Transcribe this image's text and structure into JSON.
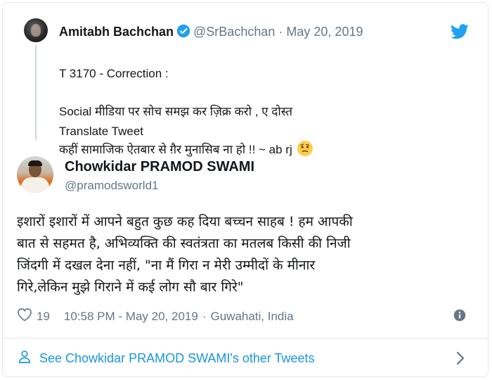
{
  "quoted_tweet": {
    "author_name": "Amitabh Bachchan",
    "handle": "@SrBachchan",
    "separator": "·",
    "date": "May 20, 2019",
    "text_lines": [
      "T 3170 - Correction :",
      "Social मीडिया पर सोच समझ कर ज़िक्र करो , ए दोस्त",
      "कहीं सामाजिक ऐतबार से ग़ैर मुनासिब ना हो  !! ~ ab rj"
    ],
    "translate_label": "Translate Tweet"
  },
  "main_tweet": {
    "author_name": "Chowkidar PRAMOD SWAMI",
    "handle": "@pramodsworld1",
    "text_lines": [
      "इशारों इशारों में आपने बहुत कुछ कह दिया बच्चन साहब ! हम आपकी",
      "बात से सहमत है, अभिव्यक्ति की स्वतंत्रता का मतलब किसी की निजी",
      "जिंदगी में दखल देना नहीं, \"ना मैं गिरा न मेरी उम्मीदों के मीनार",
      "गिरे,लेकिन मुझे गिराने में कई लोग सौ बार गिरे\""
    ],
    "likes": "19",
    "timestamp": "10:58 PM - May 20, 2019",
    "location_separator": "·",
    "location": "Guwahati, India"
  },
  "footer": {
    "link_text": "See Chowkidar PRAMOD SWAMI's other Tweets"
  },
  "icons": {
    "verified": "verified-badge-icon",
    "twitter": "twitter-bird-icon",
    "emoji": "thinking-face-emoji",
    "heart": "heart-icon",
    "info": "info-icon",
    "user": "user-icon",
    "chevron": "chevron-right-icon"
  },
  "colors": {
    "accent": "#1b95e0",
    "verified": "#1da1f2",
    "muted": "#657786",
    "text": "#14171a"
  }
}
